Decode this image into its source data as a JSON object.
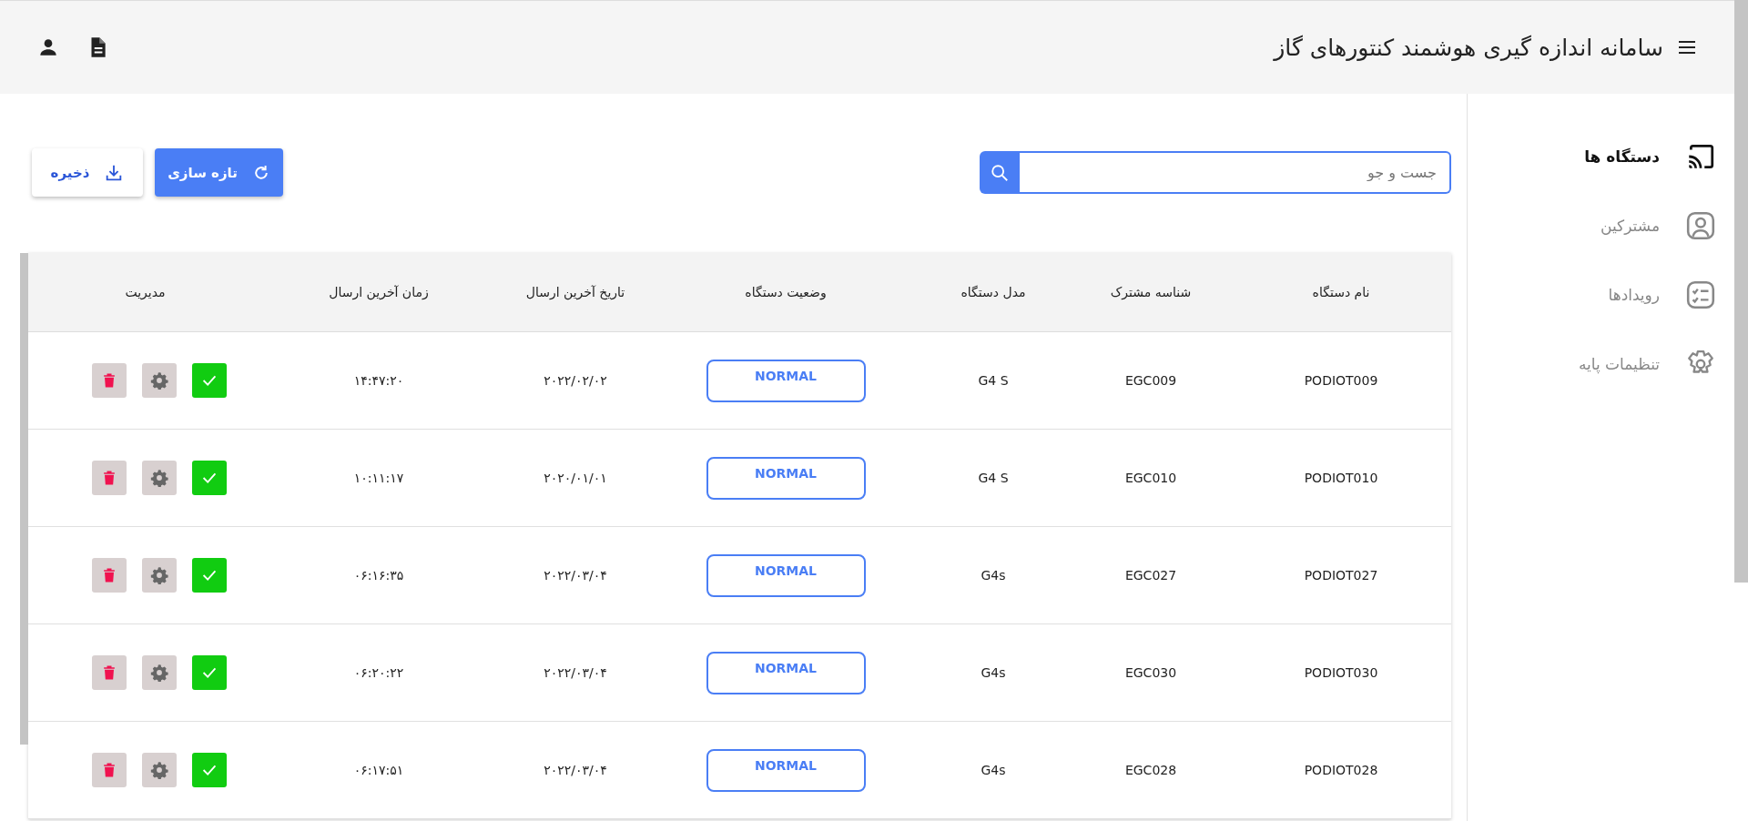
{
  "header": {
    "title": "سامانه اندازه گیری هوشمند کنتورهای گاز"
  },
  "sidebar": {
    "items": [
      {
        "label": "دستگاه ها",
        "kind": "cast",
        "selected": true
      },
      {
        "label": "مشترکین",
        "kind": "user",
        "selected": false
      },
      {
        "label": "رویدادها",
        "kind": "list",
        "selected": false
      },
      {
        "label": "تنظیمات پایه",
        "kind": "gear",
        "selected": false
      }
    ]
  },
  "search": {
    "placeholder": "جست و جو"
  },
  "buttons": {
    "refresh": "تازه سازی",
    "save": "ذخیره"
  },
  "table": {
    "columns": [
      "نام دستگاه",
      "شناسه مشترک",
      "مدل دستگاه",
      "وضعیت دستگاه",
      "تاریخ آخرین ارسال",
      "زمان آخرین ارسال",
      "مدیریت"
    ],
    "rows": [
      {
        "name": "PODIOT009",
        "subscriber": "EGC009",
        "model": "G4 S",
        "status": "NORMAL",
        "date": "۲۰۲۲/۰۲/۰۲",
        "time": "۱۴:۴۷:۲۰"
      },
      {
        "name": "PODIOT010",
        "subscriber": "EGC010",
        "model": "G4 S",
        "status": "NORMAL",
        "date": "۲۰۲۰/۰۱/۰۱",
        "time": "۱۰:۱۱:۱۷"
      },
      {
        "name": "PODIOT027",
        "subscriber": "EGC027",
        "model": "G4s",
        "status": "NORMAL",
        "date": "۲۰۲۲/۰۳/۰۴",
        "time": "۰۶:۱۶:۳۵"
      },
      {
        "name": "PODIOT030",
        "subscriber": "EGC030",
        "model": "G4s",
        "status": "NORMAL",
        "date": "۲۰۲۲/۰۳/۰۴",
        "time": "۰۶:۲۰:۲۲"
      },
      {
        "name": "PODIOT028",
        "subscriber": "EGC028",
        "model": "G4s",
        "status": "NORMAL",
        "date": "۲۰۲۲/۰۳/۰۴",
        "time": "۰۶:۱۷:۵۱"
      }
    ]
  }
}
